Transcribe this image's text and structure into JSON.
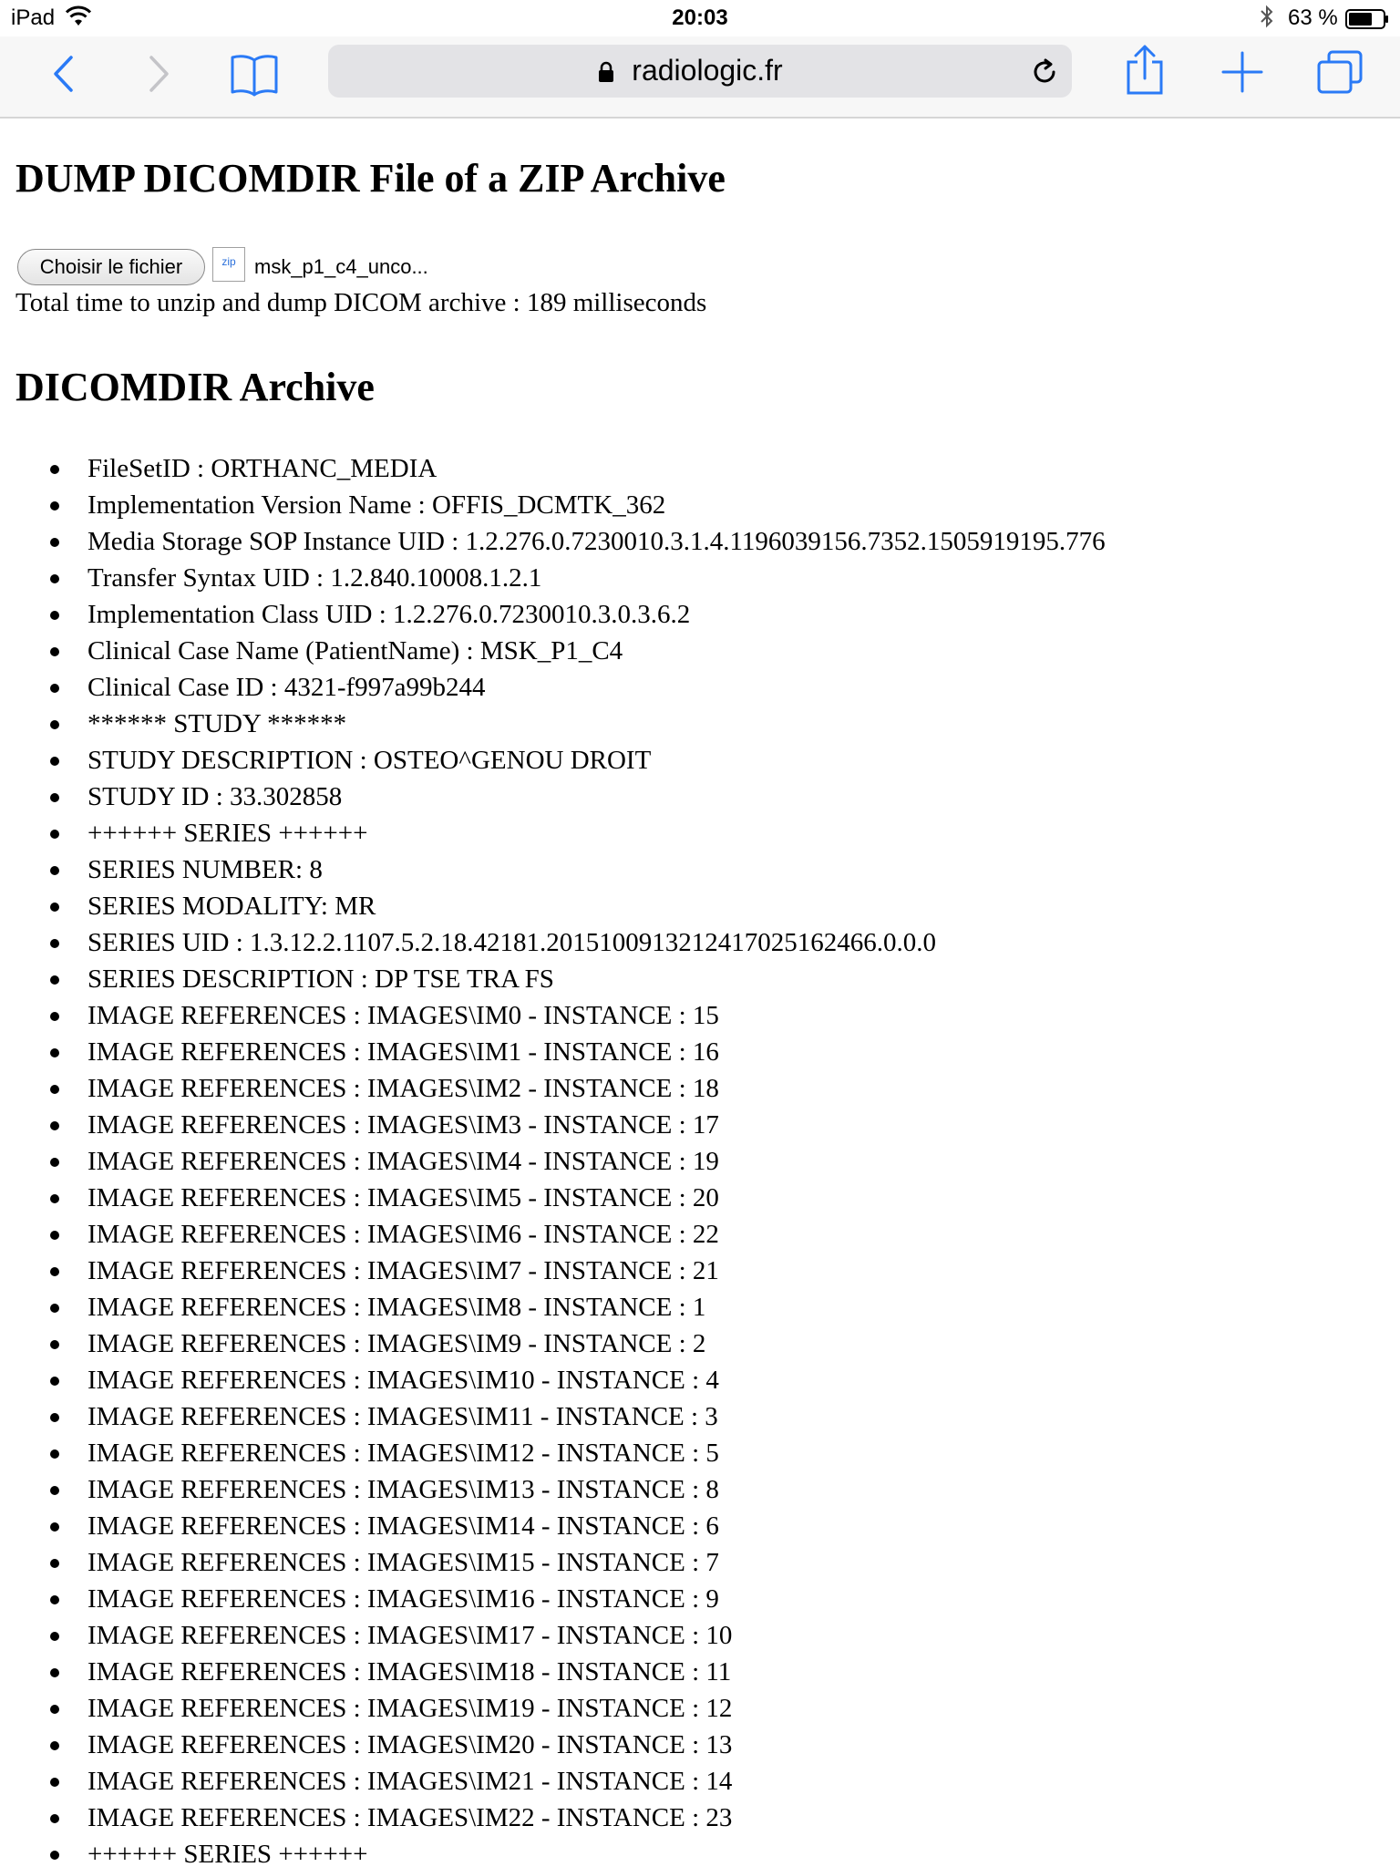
{
  "status_bar": {
    "device": "iPad",
    "time": "20:03",
    "battery_percent": "63 %"
  },
  "browser": {
    "url": "radiologic.fr",
    "accent_color": "#2a7af6"
  },
  "page": {
    "title": "DUMP DICOMDIR File of a ZIP Archive",
    "file_input": {
      "button_label": "Choisir le fichier",
      "thumb_label": "zip",
      "file_name": "msk_p1_c4_unco..."
    },
    "timing_text": "Total time to unzip and dump DICOM archive : 189 milliseconds",
    "section_title": "DICOMDIR Archive",
    "entries": [
      "FileSetID : ORTHANC_MEDIA",
      "Implementation Version Name : OFFIS_DCMTK_362",
      "Media Storage SOP Instance UID : 1.2.276.0.7230010.3.1.4.1196039156.7352.1505919195.776",
      "Transfer Syntax UID : 1.2.840.10008.1.2.1",
      "Implementation Class UID : 1.2.276.0.7230010.3.0.3.6.2",
      "Clinical Case Name (PatientName) : MSK_P1_C4",
      "Clinical Case ID : 4321-f997a99b244",
      "****** STUDY ******",
      "STUDY DESCRIPTION : OSTEO^GENOU DROIT",
      "STUDY ID : 33.302858",
      "++++++ SERIES ++++++",
      "SERIES NUMBER: 8",
      "SERIES MODALITY: MR",
      "SERIES UID : 1.3.12.2.1107.5.2.18.42181.2015100913212417025162466.0.0.0",
      "SERIES DESCRIPTION : DP TSE TRA FS",
      "IMAGE REFERENCES : IMAGES\\IM0 - INSTANCE : 15",
      "IMAGE REFERENCES : IMAGES\\IM1 - INSTANCE : 16",
      "IMAGE REFERENCES : IMAGES\\IM2 - INSTANCE : 18",
      "IMAGE REFERENCES : IMAGES\\IM3 - INSTANCE : 17",
      "IMAGE REFERENCES : IMAGES\\IM4 - INSTANCE : 19",
      "IMAGE REFERENCES : IMAGES\\IM5 - INSTANCE : 20",
      "IMAGE REFERENCES : IMAGES\\IM6 - INSTANCE : 22",
      "IMAGE REFERENCES : IMAGES\\IM7 - INSTANCE : 21",
      "IMAGE REFERENCES : IMAGES\\IM8 - INSTANCE : 1",
      "IMAGE REFERENCES : IMAGES\\IM9 - INSTANCE : 2",
      "IMAGE REFERENCES : IMAGES\\IM10 - INSTANCE : 4",
      "IMAGE REFERENCES : IMAGES\\IM11 - INSTANCE : 3",
      "IMAGE REFERENCES : IMAGES\\IM12 - INSTANCE : 5",
      "IMAGE REFERENCES : IMAGES\\IM13 - INSTANCE : 8",
      "IMAGE REFERENCES : IMAGES\\IM14 - INSTANCE : 6",
      "IMAGE REFERENCES : IMAGES\\IM15 - INSTANCE : 7",
      "IMAGE REFERENCES : IMAGES\\IM16 - INSTANCE : 9",
      "IMAGE REFERENCES : IMAGES\\IM17 - INSTANCE : 10",
      "IMAGE REFERENCES : IMAGES\\IM18 - INSTANCE : 11",
      "IMAGE REFERENCES : IMAGES\\IM19 - INSTANCE : 12",
      "IMAGE REFERENCES : IMAGES\\IM20 - INSTANCE : 13",
      "IMAGE REFERENCES : IMAGES\\IM21 - INSTANCE : 14",
      "IMAGE REFERENCES : IMAGES\\IM22 - INSTANCE : 23",
      "++++++ SERIES ++++++"
    ]
  }
}
